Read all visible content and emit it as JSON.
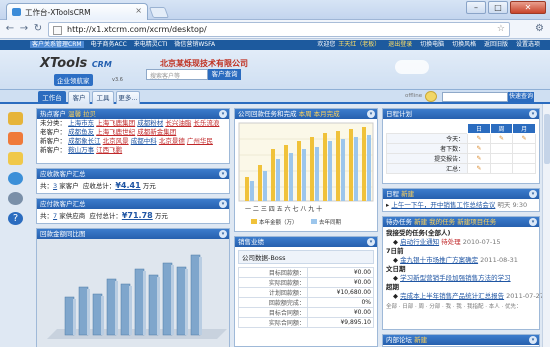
{
  "browser": {
    "tab_title": "工作台-XToolsCRM",
    "url": "http://x1.xtcrm.com/xcrm/desktop/",
    "win_buttons": [
      "–",
      "□",
      "✕"
    ]
  },
  "topstrip": {
    "links": [
      "客户关系管理CRM",
      "电子商务ACC",
      "来电精灵CTI",
      "微信营销WSFA"
    ],
    "welcome": "欢迎您",
    "user": "王天红（老板）",
    "logout": "退出登录",
    "right_links": [
      "切换电脑",
      "切换风格",
      "返回旧版",
      "设置选项"
    ]
  },
  "header": {
    "logo_main": "XTools",
    "logo_crm": "CRM",
    "logo_sub": "企业领航家",
    "version": "v3.6",
    "company": "北京某烁现技术有限公司",
    "search_placeholder": "搜索客户等",
    "search_button": "客户查询"
  },
  "app_tabs": [
    "工作台",
    "客户",
    "工具",
    "更多..."
  ],
  "right_search": {
    "offline": "offline",
    "button": "快速查询"
  },
  "panels": {
    "hot_customers": {
      "title": "热点客户",
      "link1": "温馨",
      "link2": "拉贝",
      "rows": [
        {
          "label": "未分类：",
          "items": [
            "上海市东",
            "上海飞鹿集团",
            "成都粉材",
            "长兴油脂",
            "长乐流浪"
          ]
        },
        {
          "label": "老客户：",
          "items": [
            "成都鱼友",
            "上海飞鹿世纪",
            "成都新金集团"
          ]
        },
        {
          "label": "新客户：",
          "items": [
            "成都象长江",
            "北京风景",
            "成都中科",
            "北京景德",
            "广州华民"
          ]
        },
        {
          "label": "新客户：",
          "items": [
            "鞍山万事",
            "江西飞鹏"
          ]
        }
      ]
    },
    "receivable": {
      "title": "应收款客户汇总",
      "count_prefix": "共：",
      "count": "3",
      "count_suffix": "家客户",
      "total_label": "应收总计：",
      "amount": "¥4.41",
      "unit": "万元"
    },
    "payable": {
      "title": "应付款客户汇总",
      "count_prefix": "共：",
      "count": "7",
      "count_suffix": "家供应商",
      "total_label": "应付总计：",
      "amount": "¥71.78",
      "unit": "万元"
    },
    "sales_stats": {
      "title": "回款金额同比图"
    },
    "company_tasks": {
      "title_prefix": "公司回款任务和完成",
      "title_link": "本周",
      "title_suffix": "本月完成",
      "legend": [
        "本年金额（万）",
        "去年同期"
      ],
      "months": [
        "一",
        "二",
        "三",
        "四",
        "五",
        "六",
        "七",
        "八",
        "九",
        "十"
      ]
    },
    "sales_ranking": {
      "title": "销售业绩",
      "section": "公司数据-Boss",
      "rows": [
        {
          "label": "目标回款额：",
          "value": "¥0.00"
        },
        {
          "label": "实际回款额：",
          "value": "¥0.00"
        },
        {
          "label": "计划回款额：",
          "value": "¥10,680.00"
        },
        {
          "label": "回款额完成：",
          "value": "0%"
        },
        {
          "label": "目标合同额：",
          "value": "¥0.00"
        },
        {
          "label": "实际合同额：",
          "value": "¥9,895.10"
        }
      ]
    },
    "schedule": {
      "title": "日程计划",
      "cols": [
        "日",
        "周",
        "月"
      ],
      "rows": [
        "今天：",
        "者下数：",
        "提交报告：",
        "汇总："
      ]
    },
    "diary": {
      "title": "日程",
      "link": "新建",
      "item": "上午一下午，开中销售工作总结会议",
      "time": "明天 9:30"
    },
    "tasks": {
      "title": "待办任务",
      "links": [
        "新建",
        "我的任务",
        "新建项目任务"
      ],
      "groups": [
        {
          "head": "我接受的任务(全部人)",
          "items": [
            {
              "text": "启动行业通知",
              "tag": "待处理",
              "date": "2010-07-15"
            }
          ]
        },
        {
          "head": "7日前",
          "items": [
            {
              "text": "金九银十市场推广方案确定",
              "tag": "",
              "date": "2011-08-31"
            }
          ]
        },
        {
          "head": "文日期",
          "items": [
            {
              "text": "学习新型营销手段加强销售方法的学习",
              "tag": "",
              "date": ""
            }
          ]
        },
        {
          "head": "超期",
          "items": [
            {
              "text": "完成本上半年销售产品统计汇总报告",
              "tag": "",
              "date": "2011-07-27"
            }
          ]
        }
      ],
      "filter": "全部 · 日部 · 周 · 分部 · 我 · 我 · 我指配 · 本人 · 优先：",
      "more_link": "内部论坛"
    },
    "forum": {
      "title": "内部论坛",
      "link": "新建"
    }
  }
}
